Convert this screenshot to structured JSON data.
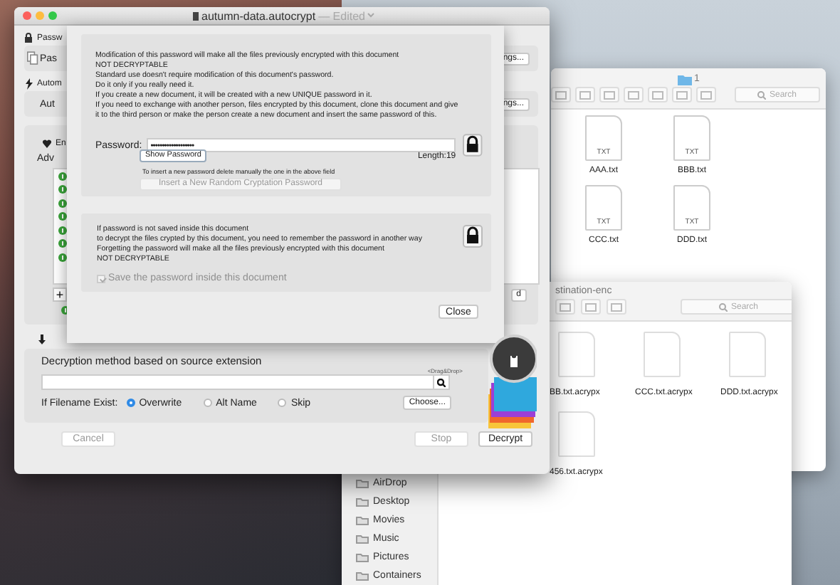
{
  "finder_windows": [
    {
      "title": "1",
      "search_placeholder": "Search",
      "files": [
        {
          "name": "AAA.txt",
          "kind": "txt",
          "badge": "TXT"
        },
        {
          "name": "BBB.txt",
          "kind": "txt",
          "badge": "TXT"
        },
        {
          "name": "CCC.txt",
          "kind": "txt",
          "badge": "TXT"
        },
        {
          "name": "DDD.txt",
          "kind": "txt",
          "badge": "TXT"
        }
      ]
    },
    {
      "title": "stination-enc",
      "search_placeholder": "Search",
      "sidebar": [
        {
          "label": "AirDrop"
        },
        {
          "label": "Desktop"
        },
        {
          "label": "Movies"
        },
        {
          "label": "Music"
        },
        {
          "label": "Pictures"
        },
        {
          "label": "Containers"
        }
      ],
      "files": [
        {
          "name": "BB.txt.acrypx",
          "kind": "blank"
        },
        {
          "name": "CCC.txt.acrypx",
          "kind": "blank"
        },
        {
          "name": "DDD.txt.acrypx",
          "kind": "blank"
        },
        {
          "name": "456.txt.acrypx",
          "kind": "blank"
        }
      ]
    }
  ],
  "main_window": {
    "title": "autumn-data.autocrypt",
    "title_status": "— Edited",
    "behind_sheet": {
      "sections": [
        {
          "heading": "Passw",
          "label": "Pas",
          "button": "ngs..."
        },
        {
          "heading": "Autom",
          "label": "Aut",
          "button": "ngs..."
        }
      ],
      "encryption": {
        "heading": "En",
        "label": "Adv",
        "list_items": [
          {
            "kind": "enabled"
          },
          {
            "kind": "enabled"
          },
          {
            "kind": "enabled"
          },
          {
            "kind": "enabled"
          },
          {
            "kind": "enabled"
          },
          {
            "kind": "enabled"
          },
          {
            "kind": "enabled"
          }
        ],
        "add_button": "+",
        "button": "d"
      }
    },
    "decryption": {
      "method_label": "Decryption method based on source extension",
      "drop_hint": "<Drag&Drop>",
      "exists_label": "If Filename Exist:",
      "options": [
        {
          "label": "Overwrite",
          "selected": true
        },
        {
          "label": "Alt Name",
          "selected": false
        },
        {
          "label": "Skip",
          "selected": false
        }
      ],
      "choose_button": "Choose..."
    },
    "buttons": [
      {
        "label": "Cancel",
        "disabled": true
      },
      {
        "label": "Stop",
        "disabled": true
      },
      {
        "label": "Decrypt",
        "disabled": false
      }
    ],
    "sheet": {
      "warning_lines": [
        "Modification of this password will make all the files previously encrypted with this document",
        "NOT DECRYPTABLE",
        "Standard use doesn't require modification of this document's password.",
        "Do it only if you really need it.",
        "If you create a new document, it will be created with a new UNIQUE password in it.",
        "If you need to exchange with another person, files encrypted by this document, clone this document and give",
        " it to the third person or make the person create a new document and insert the same password of this."
      ],
      "password_label": "Password:",
      "password_value": "•••••••••••••••••••",
      "show_password_button": "Show Password",
      "length_label": "Length:",
      "length_value": "19",
      "hint": "To insert a new password delete manually the one in the above field",
      "insert_button": {
        "label": "Insert a New Random Cryptation Password",
        "disabled": true
      },
      "save_lines": [
        "If password is not saved inside this document",
        "to decrypt the files crypted by this document, you need to remember the password in another way",
        "Forgetting the password will make all the files previously encrypted with this document",
        "NOT DECRYPTABLE"
      ],
      "save_checkbox": {
        "label": "Save the password inside this document",
        "checked": true,
        "disabled": true
      },
      "close_button": "Close"
    }
  }
}
